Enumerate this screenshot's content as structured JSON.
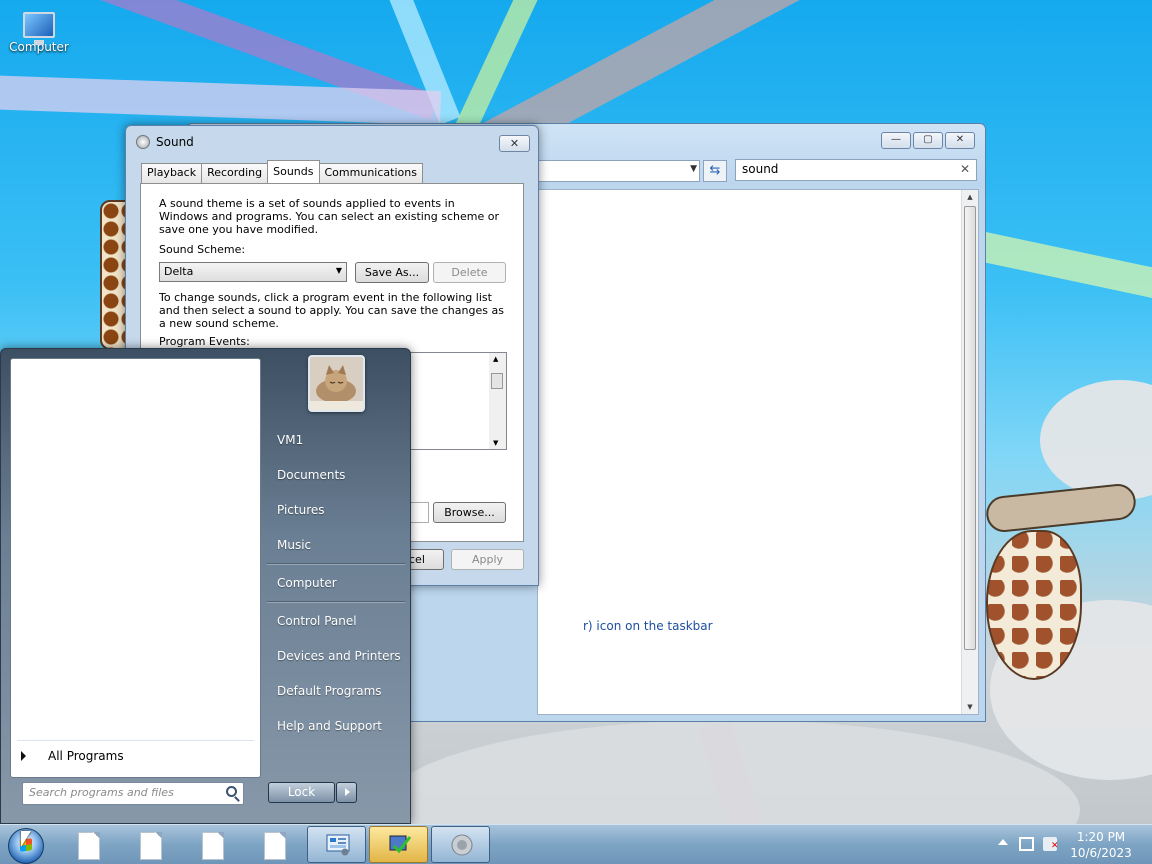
{
  "desktop": {
    "icons": [
      {
        "label": "Computer",
        "icon": "computer-monitor-icon"
      }
    ]
  },
  "explorer": {
    "search_value": "sound",
    "search_clear": "✕",
    "minimize": "—",
    "maximize": "▢",
    "close": "✕",
    "link_fragment": "r) icon on the taskbar"
  },
  "sound_dialog": {
    "title": "Sound",
    "close": "✕",
    "tabs": [
      "Playback",
      "Recording",
      "Sounds",
      "Communications"
    ],
    "active_tab": "Sounds",
    "description": "A sound theme is a set of sounds applied to events in Windows and programs.  You can select an existing scheme or save one you have modified.",
    "scheme_label": "Sound Scheme:",
    "scheme_value": "Delta",
    "save_as": "Save As...",
    "delete": "Delete",
    "instructions": "To change sounds, click a program event in the following list and then select a sound to apply.  You can save the changes as a new sound scheme.",
    "events_label": "Program Events:",
    "browse": "Browse...",
    "cancel_fragment": "cel",
    "apply": "Apply"
  },
  "start_menu": {
    "all_programs": "All Programs",
    "search_placeholder": "Search programs and files",
    "right_items": [
      "VM1",
      "Documents",
      "Pictures",
      "Music",
      "Computer",
      "Control Panel",
      "Devices and Printers",
      "Default Programs",
      "Help and Support"
    ],
    "lock": "Lock"
  },
  "taskbar": {
    "time": "1:20 PM",
    "date": "10/6/2023",
    "pinned": [
      "document-icon",
      "document-icon",
      "document-icon",
      "document-icon",
      "control-panel-icon",
      "action-center-icon",
      "sound-icon"
    ]
  }
}
